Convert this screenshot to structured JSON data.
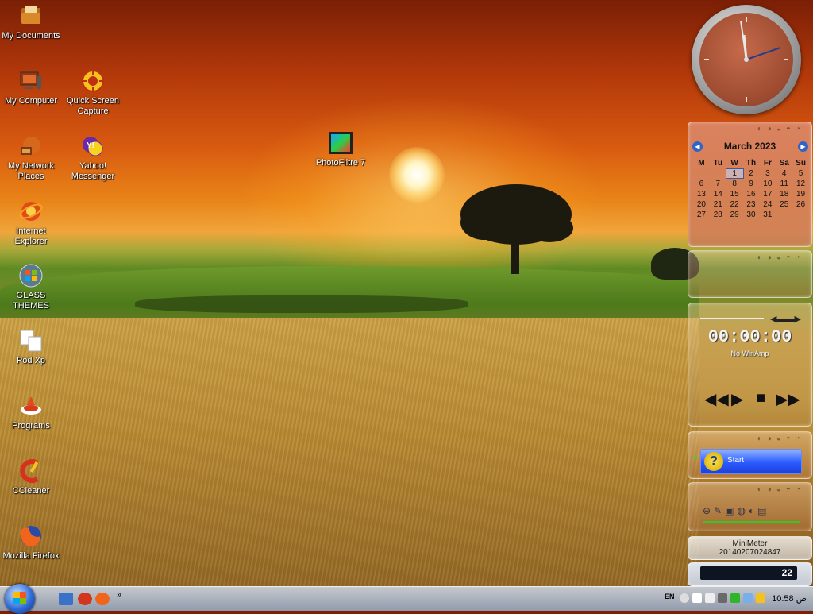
{
  "desktop_icons": [
    {
      "label": "My Documents",
      "icon": "folder-documents-icon"
    },
    {
      "label": "My Computer",
      "icon": "computer-icon"
    },
    {
      "label": "Quick Screen Capture",
      "icon": "screen-capture-icon"
    },
    {
      "label": "My Network Places",
      "icon": "network-places-icon"
    },
    {
      "label": "Yahoo! Messenger",
      "icon": "yahoo-messenger-icon"
    },
    {
      "label": "PhotoFiltre 7",
      "icon": "photofiltre-icon"
    },
    {
      "label": "Internet Explorer",
      "icon": "internet-explorer-icon"
    },
    {
      "label": "GLASS THEMES",
      "icon": "windows-orb-icon"
    },
    {
      "label": "Pod Xp",
      "icon": "pod-xp-icon"
    },
    {
      "label": "Programs",
      "icon": "programs-icon"
    },
    {
      "label": "CCleaner",
      "icon": "ccleaner-icon"
    },
    {
      "label": "Mozilla Firefox",
      "icon": "firefox-icon"
    }
  ],
  "calendar": {
    "month": "March 2023",
    "day_headers": [
      "M",
      "Tu",
      "W",
      "Th",
      "Fr",
      "Sa",
      "Su"
    ],
    "weeks": [
      [
        "",
        "",
        "1",
        "2",
        "3",
        "4",
        "5"
      ],
      [
        "6",
        "7",
        "8",
        "9",
        "10",
        "11",
        "12"
      ],
      [
        "13",
        "14",
        "15",
        "16",
        "17",
        "18",
        "19"
      ],
      [
        "20",
        "21",
        "22",
        "23",
        "24",
        "25",
        "26"
      ],
      [
        "27",
        "28",
        "29",
        "30",
        "31",
        "",
        ""
      ]
    ],
    "today": "1"
  },
  "player": {
    "time": "00:00:00",
    "status": "No WinAmp"
  },
  "start_gadget": {
    "label": "Start"
  },
  "minimeter": {
    "title": "MiniMeter",
    "value": "20140207024847"
  },
  "small_widget": {
    "value": "22"
  },
  "taskbar": {
    "language": "EN",
    "clock": "10:58 ص"
  },
  "colors": {
    "accent": "#2f63c7",
    "start_button": "#2a5bff",
    "calendar_bg": "#d88a6c"
  }
}
